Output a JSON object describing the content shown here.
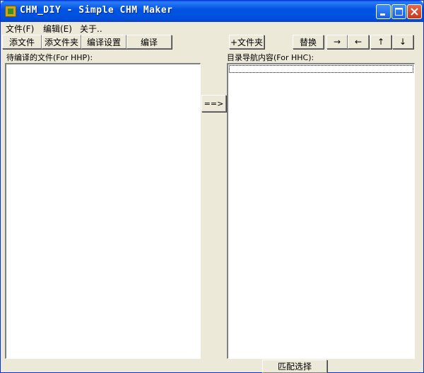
{
  "window": {
    "title": "CHM_DIY - Simple CHM Maker"
  },
  "menu": {
    "items": [
      "文件(F)",
      "编辑(E)",
      "关于.."
    ]
  },
  "left_toolbar": {
    "add_file": "添文件",
    "add_folder": "添文件夹",
    "settings": "编译设置",
    "compile": "编译"
  },
  "right_toolbar": {
    "add_folder": "+文件夹",
    "replace": "替换",
    "right": "→",
    "left": "←",
    "up": "↑",
    "down": "↓"
  },
  "left_panel": {
    "label": "待编译的文件(For HHP):"
  },
  "right_panel": {
    "label": "目录导航内容(For HHC):"
  },
  "transfer_button": "==>",
  "match_button": "匹配选择"
}
